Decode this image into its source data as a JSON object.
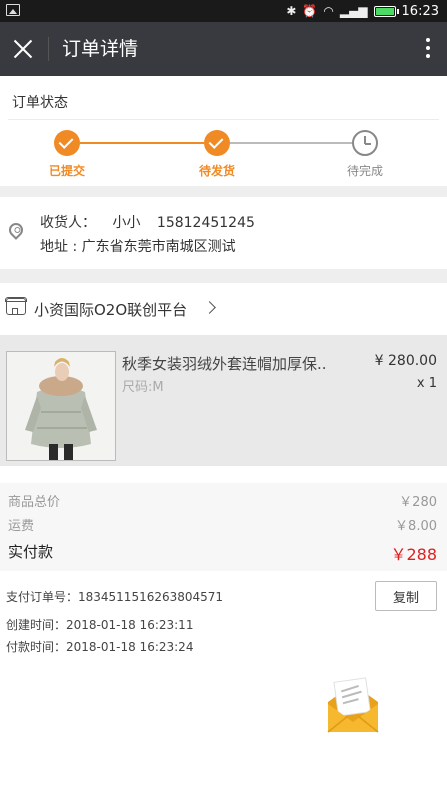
{
  "status_bar": {
    "time": "16:23"
  },
  "header": {
    "title": "订单详情"
  },
  "order_status": {
    "label": "订单状态",
    "steps": [
      {
        "label": "已提交",
        "state": "done"
      },
      {
        "label": "待发货",
        "state": "done"
      },
      {
        "label": "待完成",
        "state": "pending"
      }
    ]
  },
  "address": {
    "recipient_label": "收货人：",
    "recipient_name": "小小",
    "phone": "15812451245",
    "address_text": "地址 : 广东省东莞市南城区测试"
  },
  "shop": {
    "name": "小资国际O2O联创平台"
  },
  "product": {
    "name": "秋季女装羽绒外套连帽加厚保..",
    "size": "尺码:M",
    "price": "¥ 280.00",
    "quantity": "x 1"
  },
  "cost": {
    "subtotal_label": "商品总价",
    "subtotal_value": "￥280",
    "shipping_label": "运费",
    "shipping_value": "￥8.00",
    "total_label": "实付款",
    "total_value": "￥288"
  },
  "order_info": {
    "order_no": "支付订单号：1834511516263804571",
    "created": "创建时间：2018-01-18 16:23:11",
    "paid": "付款时间：2018-01-18 16:23:24",
    "copy_label": "复制"
  },
  "colors": {
    "accent": "#f08a24",
    "price_red": "#e02020",
    "titlebar": "#393a3f"
  }
}
